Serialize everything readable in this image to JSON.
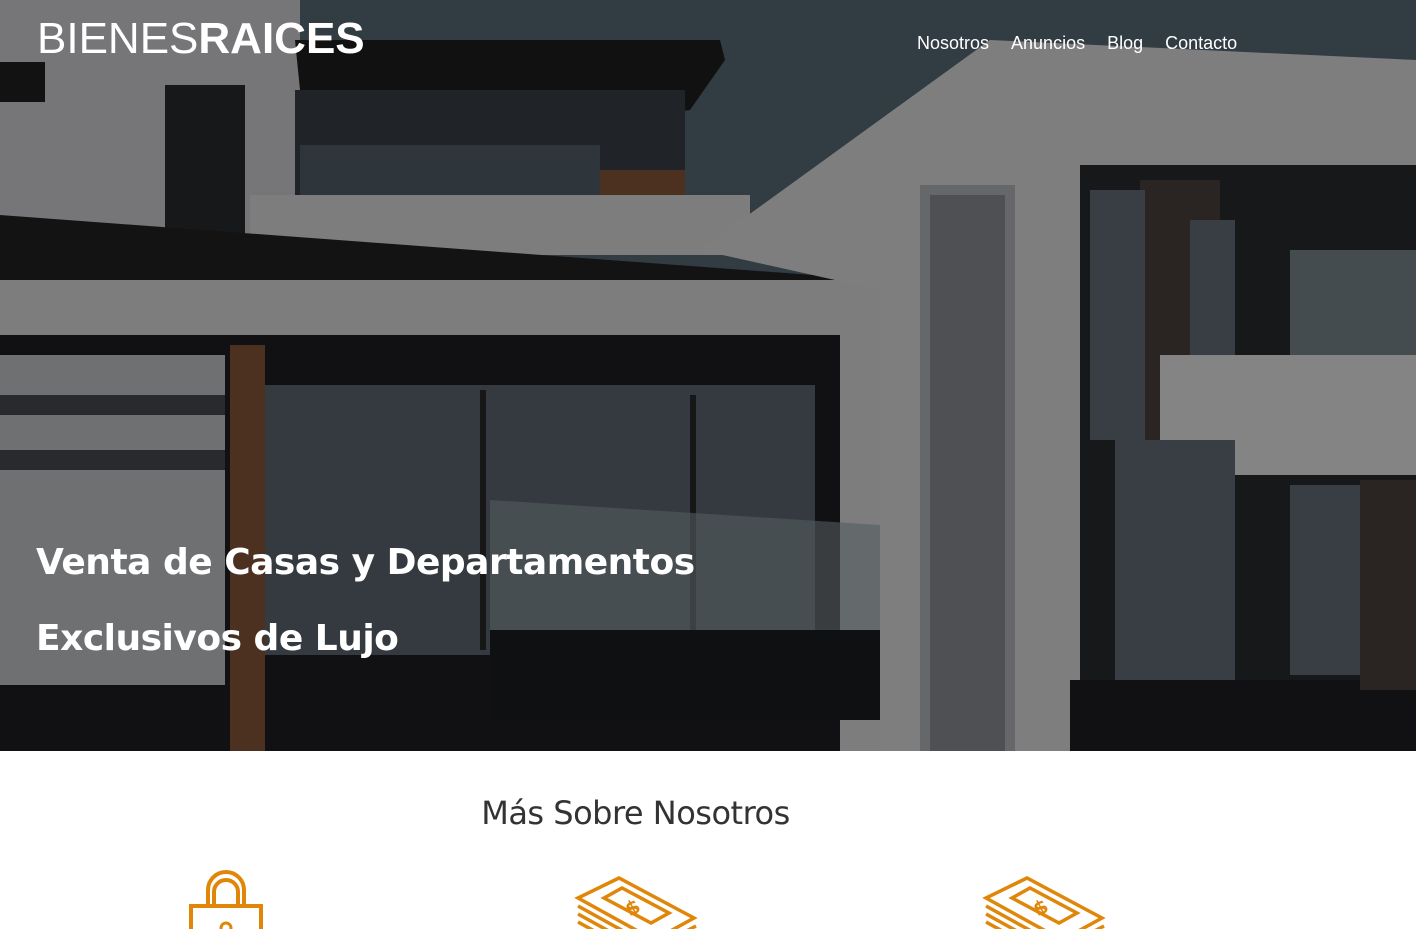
{
  "header": {
    "logo_light": "BIENES",
    "logo_bold": "RAICES",
    "nav": [
      {
        "label": "Nosotros"
      },
      {
        "label": "Anuncios"
      },
      {
        "label": "Blog"
      },
      {
        "label": "Contacto"
      }
    ]
  },
  "hero": {
    "heading_line1": "Venta de Casas y Departamentos",
    "heading_line2": "Exclusivos de Lujo"
  },
  "about": {
    "title": "Más Sobre Nosotros",
    "icons": [
      "lock-icon",
      "money-icon",
      "money-icon"
    ]
  },
  "colors": {
    "accent": "#E08709",
    "hero_text": "#FFFFFF",
    "title_text": "#333333"
  }
}
